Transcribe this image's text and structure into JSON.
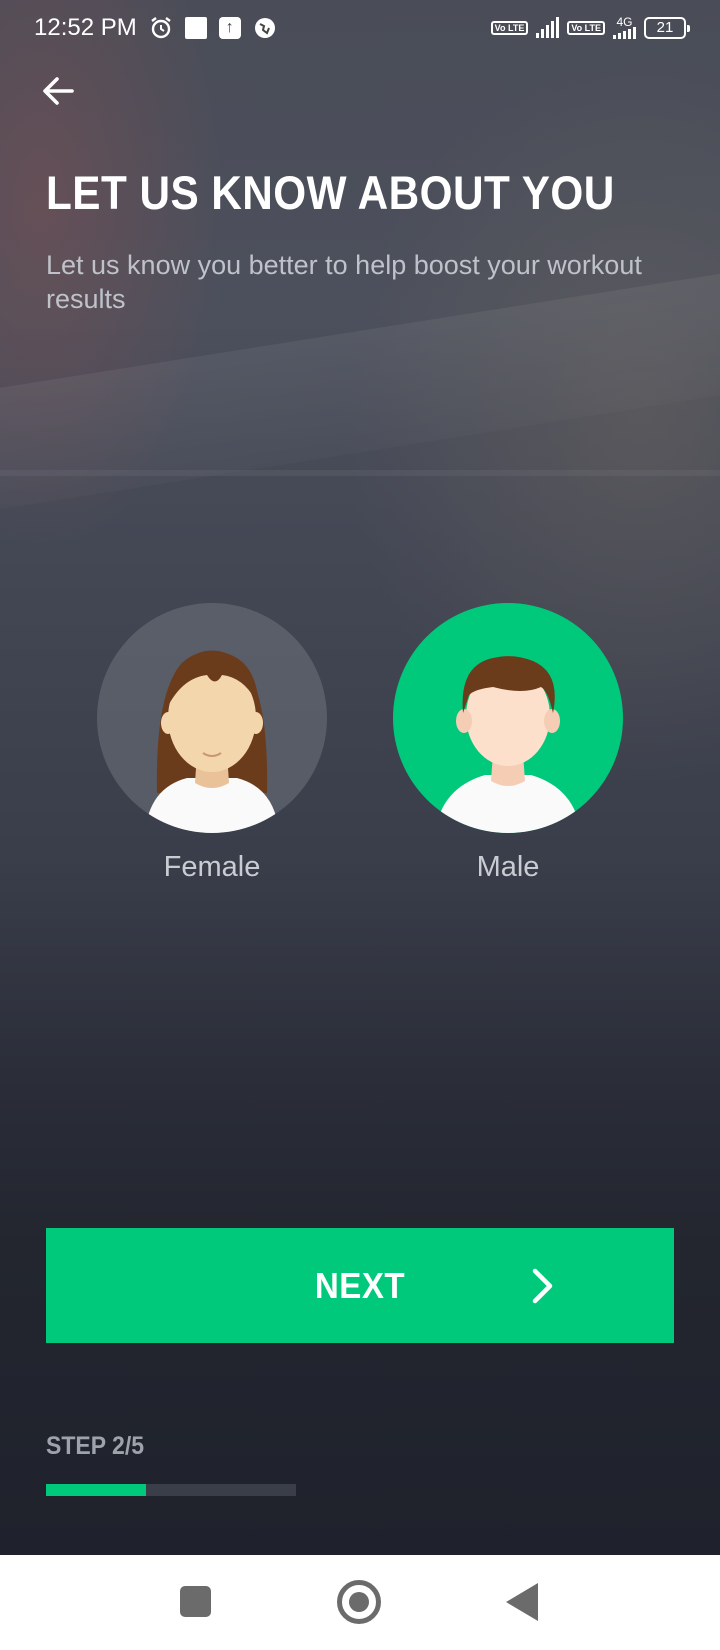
{
  "status_bar": {
    "time": "12:52 PM",
    "icons": [
      "alarm-icon",
      "notification-square-icon",
      "upload-icon",
      "vpn-icon",
      "volte-icon",
      "signal-icon",
      "volte-icon",
      "4g-signal-icon",
      "battery-icon"
    ],
    "network_type": "4G",
    "volte_label": "Vo LTE",
    "battery_level": "21"
  },
  "header": {
    "back_icon": "arrow-left-icon",
    "title": "LET US KNOW ABOUT YOU",
    "subtitle": "Let us know you better to help boost your workout results"
  },
  "gender": {
    "options": [
      {
        "label": "Female",
        "selected": false
      },
      {
        "label": "Male",
        "selected": true
      }
    ]
  },
  "actions": {
    "next_label": "NEXT",
    "next_icon": "chevron-right-icon"
  },
  "progress": {
    "step_label": "STEP 2/5",
    "fraction": 0.4
  },
  "nav_bar": {
    "icons": [
      "recents-square-icon",
      "home-circle-icon",
      "back-triangle-icon"
    ]
  },
  "colors": {
    "accent": "#00c97b",
    "background": "#1f222c",
    "text_secondary": "#bfc2c9"
  }
}
